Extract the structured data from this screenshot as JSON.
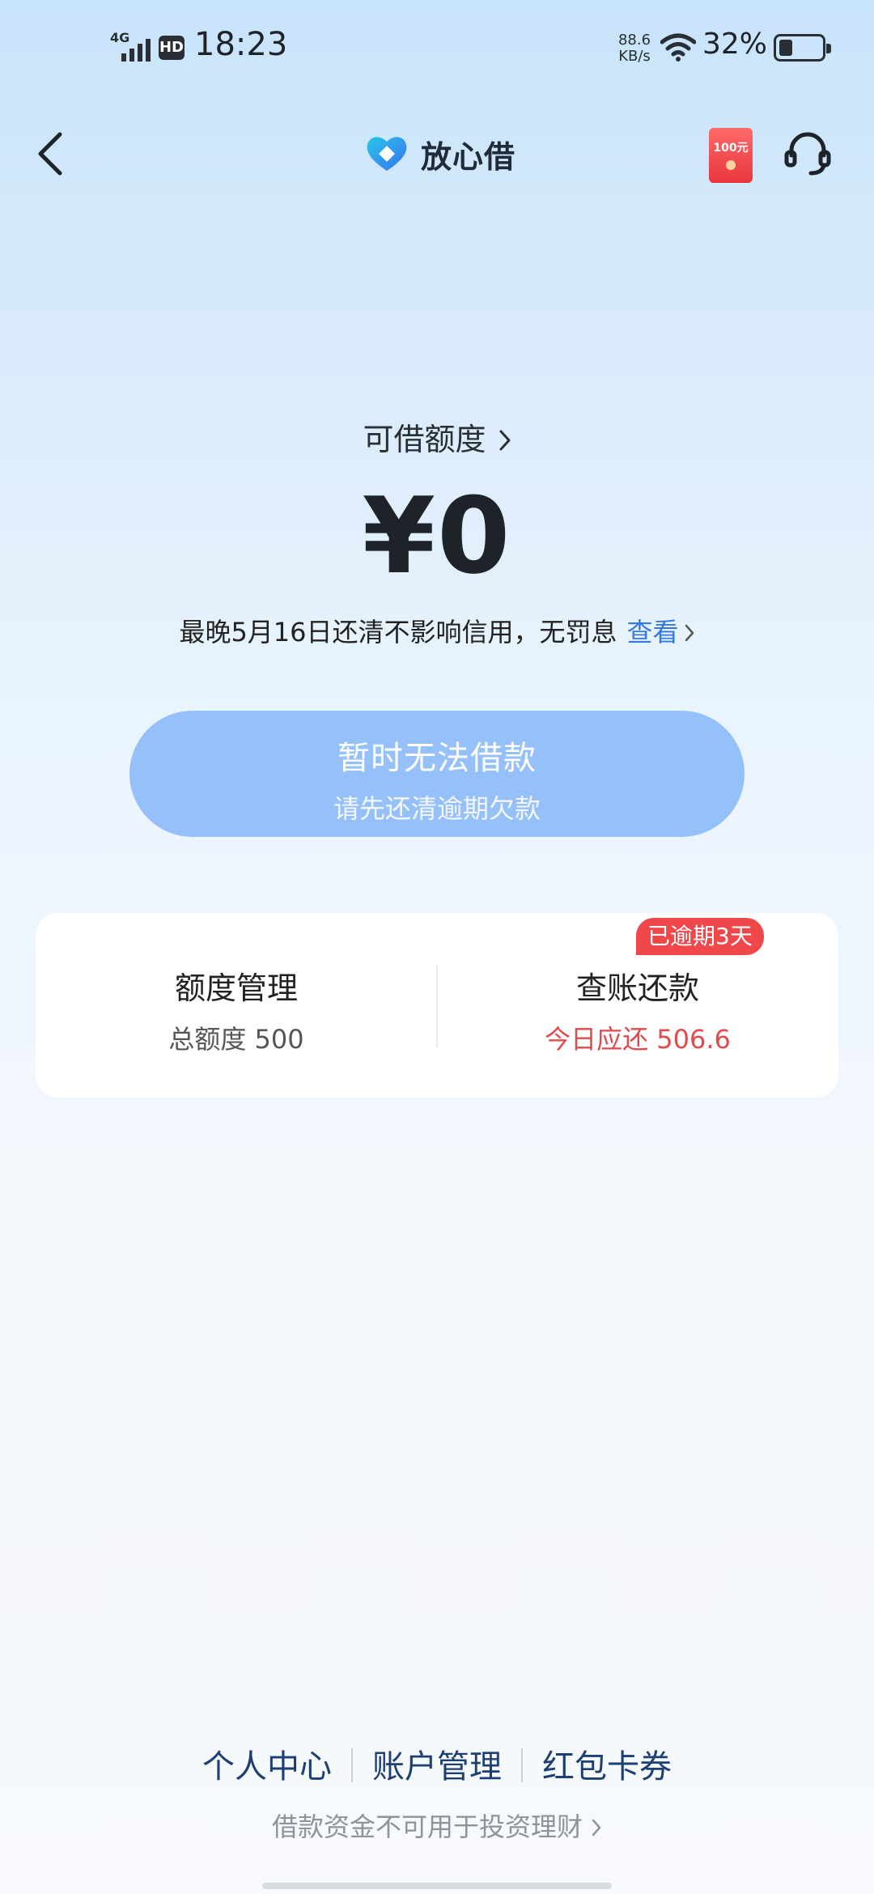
{
  "status_bar": {
    "network": "4G",
    "hd": "HD",
    "time": "18:23",
    "speed_value": "88.6",
    "speed_unit": "KB/s",
    "battery_percent": "32%",
    "battery_level": 0.32
  },
  "nav": {
    "logo_text": "放心借",
    "redpack_amount": "100元"
  },
  "credit": {
    "label": "可借额度",
    "amount": "¥0",
    "repay_note": "最晚5月16日还清不影响信用，无罚息",
    "view_link": "查看"
  },
  "borrow_button": {
    "main": "暂时无法借款",
    "sub": "请先还清逾期欠款"
  },
  "card": {
    "left": {
      "title": "额度管理",
      "sub": "总额度 500"
    },
    "right": {
      "title": "查账还款",
      "sub": "今日应还 506.6"
    },
    "overdue_badge": "已逾期3天"
  },
  "footer": {
    "links": [
      "个人中心",
      "账户管理",
      "红包卡券"
    ],
    "note": "借款资金不可用于投资理财"
  },
  "colors": {
    "accent": "#3478e6",
    "button_bg": "#96c0fa",
    "alert": "#e14b4b",
    "badge": "#f0484a"
  }
}
